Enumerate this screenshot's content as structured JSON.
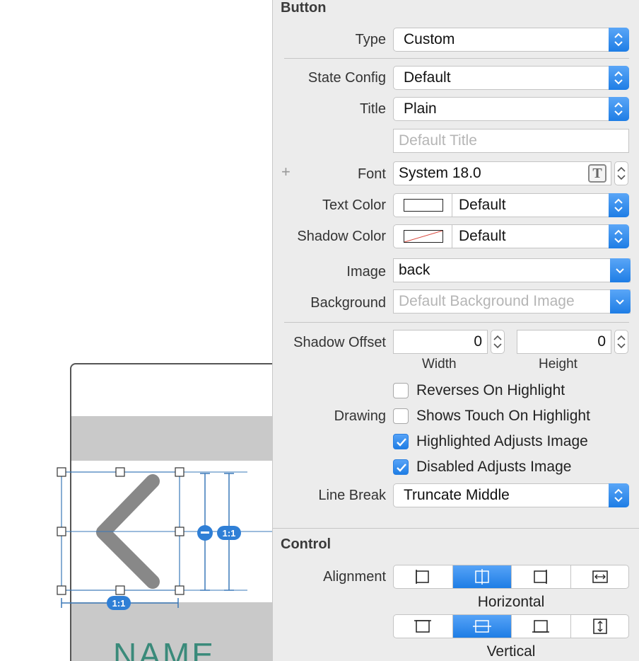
{
  "canvas": {
    "name_label": "NAME",
    "ratio_badge_vertical": "1:1",
    "ratio_badge_horizontal": "1:1"
  },
  "button_section": {
    "title": "Button",
    "type_label": "Type",
    "type_value": "Custom",
    "state_config_label": "State Config",
    "state_config_value": "Default",
    "title_label": "Title",
    "title_value": "Plain",
    "title_placeholder": "Default Title",
    "font_add": "+",
    "font_label": "Font",
    "font_value": "System 18.0",
    "font_picker_glyph": "T",
    "text_color_label": "Text Color",
    "text_color_value": "Default",
    "shadow_color_label": "Shadow Color",
    "shadow_color_value": "Default",
    "image_label": "Image",
    "image_value": "back",
    "background_label": "Background",
    "background_placeholder": "Default Background Image",
    "shadow_offset_label": "Shadow Offset",
    "shadow_width_value": "0",
    "shadow_height_value": "0",
    "width_caption": "Width",
    "height_caption": "Height",
    "drawing_label": "Drawing",
    "reverses_label": "Reverses On Highlight",
    "shows_touch_label": "Shows Touch On Highlight",
    "highlighted_adjusts_label": "Highlighted Adjusts Image",
    "disabled_adjusts_label": "Disabled Adjusts Image",
    "reverses_checked": false,
    "shows_touch_checked": false,
    "highlighted_adjusts_checked": true,
    "disabled_adjusts_checked": true,
    "line_break_label": "Line Break",
    "line_break_value": "Truncate Middle"
  },
  "control_section": {
    "title": "Control",
    "alignment_label": "Alignment",
    "horizontal_caption": "Horizontal",
    "vertical_caption": "Vertical",
    "horizontal_selected": "center",
    "vertical_selected": "center"
  },
  "colors": {
    "accent": "#1e7de5",
    "name_label": "#3a8a7a",
    "constraint_line": "#3a78b8"
  }
}
